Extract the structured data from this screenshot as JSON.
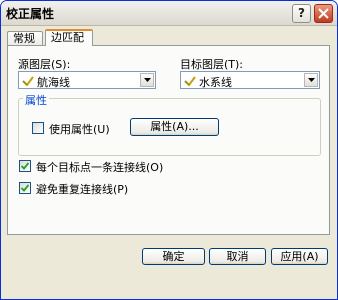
{
  "window": {
    "title": "校正属性"
  },
  "titlebar": {
    "help_glyph": "?"
  },
  "tabs": [
    {
      "label": "常规",
      "active": false
    },
    {
      "label": "边匹配",
      "active": true
    }
  ],
  "source_layer": {
    "label": "源图层(S):",
    "value": "航海线",
    "icon": "line-layer-icon"
  },
  "target_layer": {
    "label": "目标图层(T):",
    "value": "水系线",
    "icon": "line-layer-icon"
  },
  "attributes": {
    "group_title": "属性",
    "use_attributes_label": "使用属性(U)",
    "use_attributes_checked": false,
    "attributes_button": "属性(A)..."
  },
  "options": [
    {
      "label": "每个目标点一条连接线(O)",
      "checked": true
    },
    {
      "label": "避免重复连接线(P)",
      "checked": true
    }
  ],
  "buttons": {
    "ok": "确定",
    "cancel": "取消",
    "apply": "应用(A)"
  },
  "colors": {
    "title_gradient_top": "#f2f1ee",
    "group_title": "#0046d5",
    "close_button": "#c0391d",
    "active_tab_accent": "#e68b2c"
  }
}
